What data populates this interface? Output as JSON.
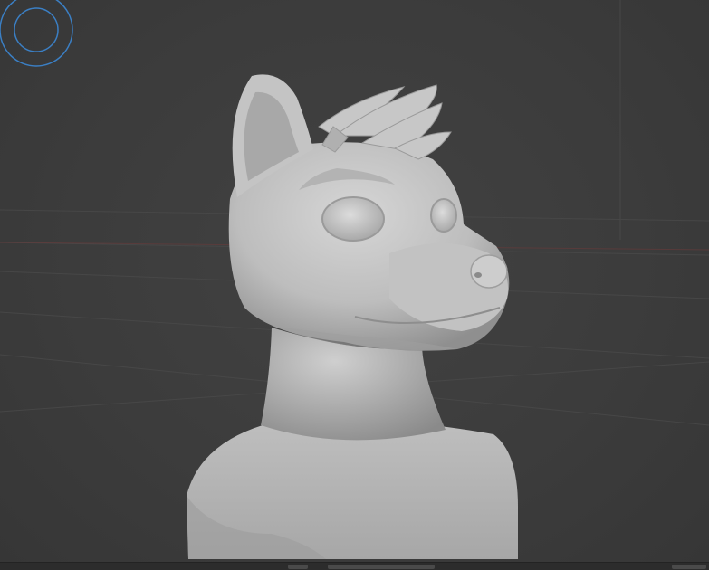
{
  "app": {
    "viewport": {
      "shading": "solid",
      "grid": true,
      "sculpt_mode": true
    },
    "icons": {
      "brush_cursor": "brush-circle-icon"
    },
    "colors": {
      "viewport_bg": "#3d3d3d",
      "grid_line": "#4a4a4a",
      "axis_x": "#6b3a3a",
      "axis_y": "#4c5a3a",
      "brush_cursor": "#3b7fc4",
      "model": "#c9c9c9",
      "status_bar": "#2c2c2c"
    }
  }
}
